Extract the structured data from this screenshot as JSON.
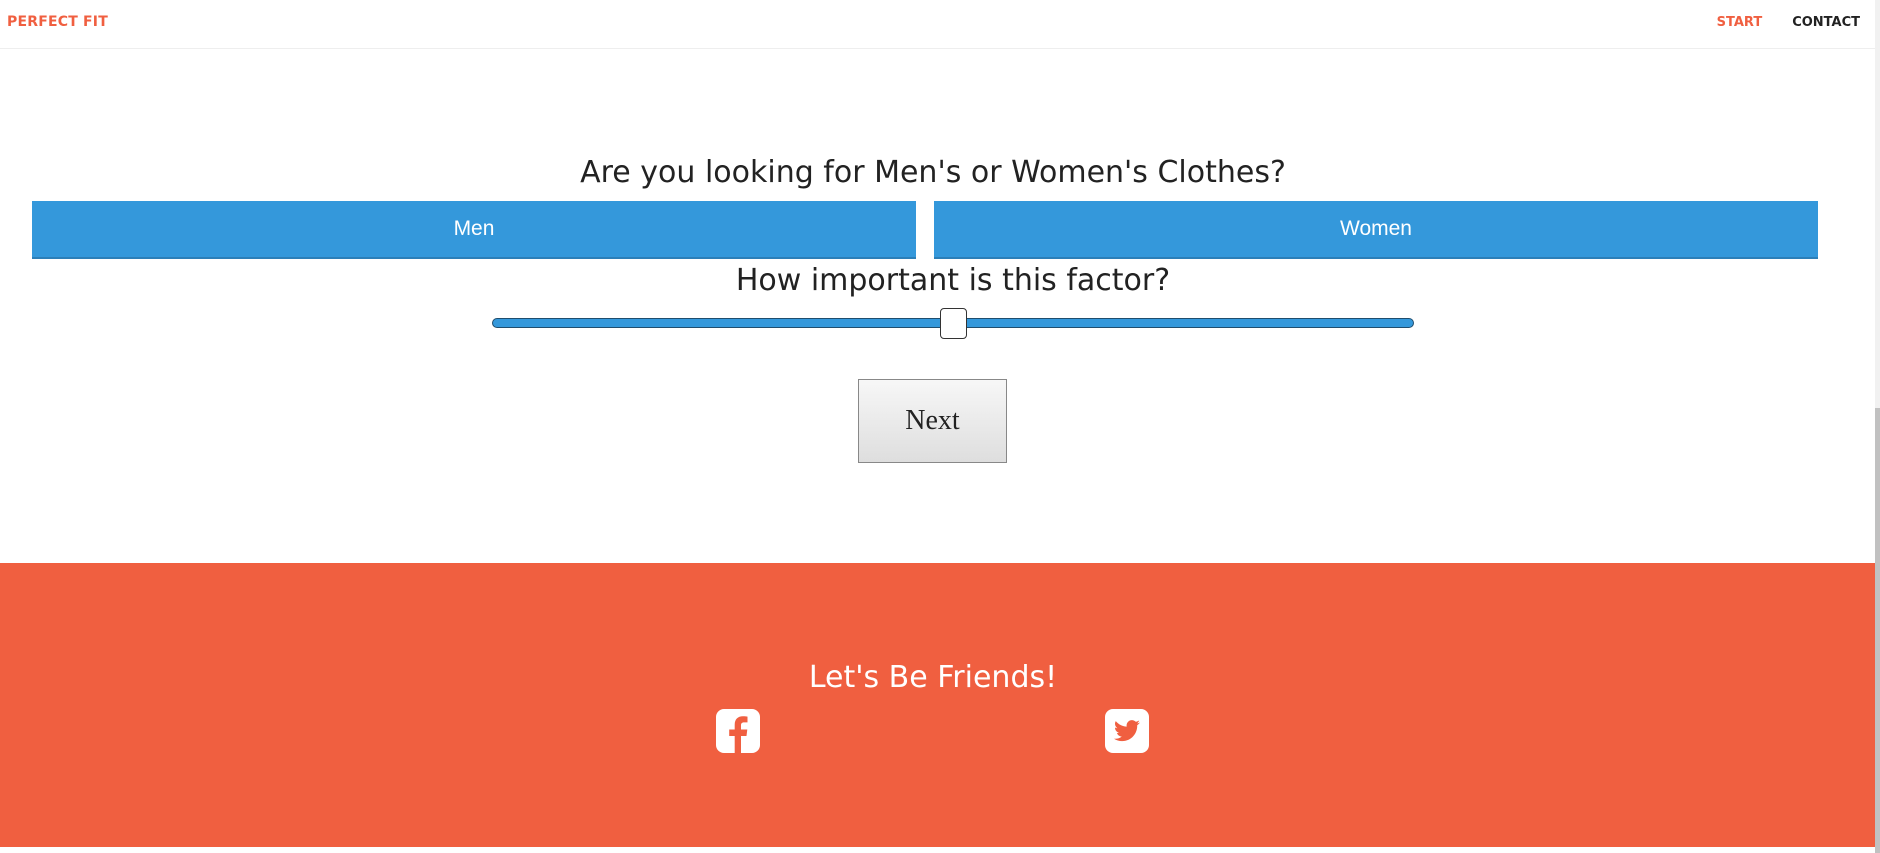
{
  "nav": {
    "brand": "PERFECT FIT",
    "links": [
      {
        "label": "START",
        "active": true
      },
      {
        "label": "CONTACT",
        "active": false
      }
    ]
  },
  "question": {
    "text": "Are you looking for Men's or Women's Clothes?",
    "options": [
      "Men",
      "Women"
    ]
  },
  "factor": {
    "label": "How important is this factor?",
    "slider_value_fraction": 0.5
  },
  "next_button": "Next",
  "footer": {
    "title": "Let's Be Friends!",
    "social_icons": [
      "facebook-icon",
      "twitter-icon"
    ]
  },
  "colors": {
    "accent": "#f05f40",
    "button_blue": "#3498db"
  }
}
